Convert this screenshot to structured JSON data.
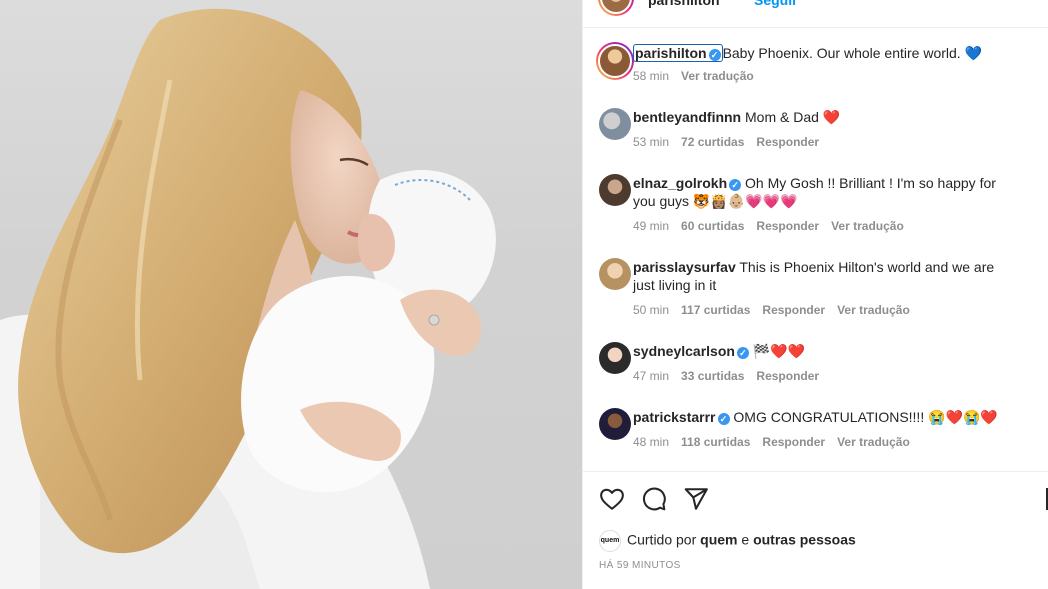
{
  "header": {
    "username": "parishilton",
    "follow_label": "Seguir"
  },
  "caption": {
    "username": "parishilton",
    "text": "Baby Phoenix. Our whole entire world. 💙",
    "time": "58 min",
    "translate": "Ver tradução"
  },
  "comments": [
    {
      "username": "bentleyandfinnn",
      "verified": false,
      "text": "Mom & Dad ❤️",
      "time": "53 min",
      "likes": "72 curtidas",
      "reply": "Responder",
      "translate": ""
    },
    {
      "username": "elnaz_golrokh",
      "verified": true,
      "text": "Oh My Gosh !! Brilliant ! I'm so happy for you guys 🐯👸🏽👶🏼💗💗💗",
      "time": "49 min",
      "likes": "60 curtidas",
      "reply": "Responder",
      "translate": "Ver tradução"
    },
    {
      "username": "parisslaysurfav",
      "verified": false,
      "text": "This is Phoenix Hilton's world and we are just living in it",
      "time": "50 min",
      "likes": "117 curtidas",
      "reply": "Responder",
      "translate": "Ver tradução"
    },
    {
      "username": "sydneylcarlson",
      "verified": true,
      "text": "🏁❤️❤️",
      "time": "47 min",
      "likes": "33 curtidas",
      "reply": "Responder",
      "translate": ""
    },
    {
      "username": "patrickstarrr",
      "verified": true,
      "text": "OMG CONGRATULATIONS!!!! 😭❤️😭❤️",
      "time": "48 min",
      "likes": "118 curtidas",
      "reply": "Responder",
      "translate": "Ver tradução"
    }
  ],
  "likes": {
    "badge": "quem",
    "prefix": "Curtido por",
    "user": "quem",
    "connector": "e",
    "others": "outras pessoas"
  },
  "timestamp": "HÁ 59 MINUTOS",
  "icons": [
    "heart-icon",
    "comment-icon",
    "share-icon",
    "verified-icon"
  ],
  "colors": {
    "link": "#0095f6",
    "verified": "#3897f0",
    "text": "#262626",
    "muted": "#8e8e8e"
  }
}
